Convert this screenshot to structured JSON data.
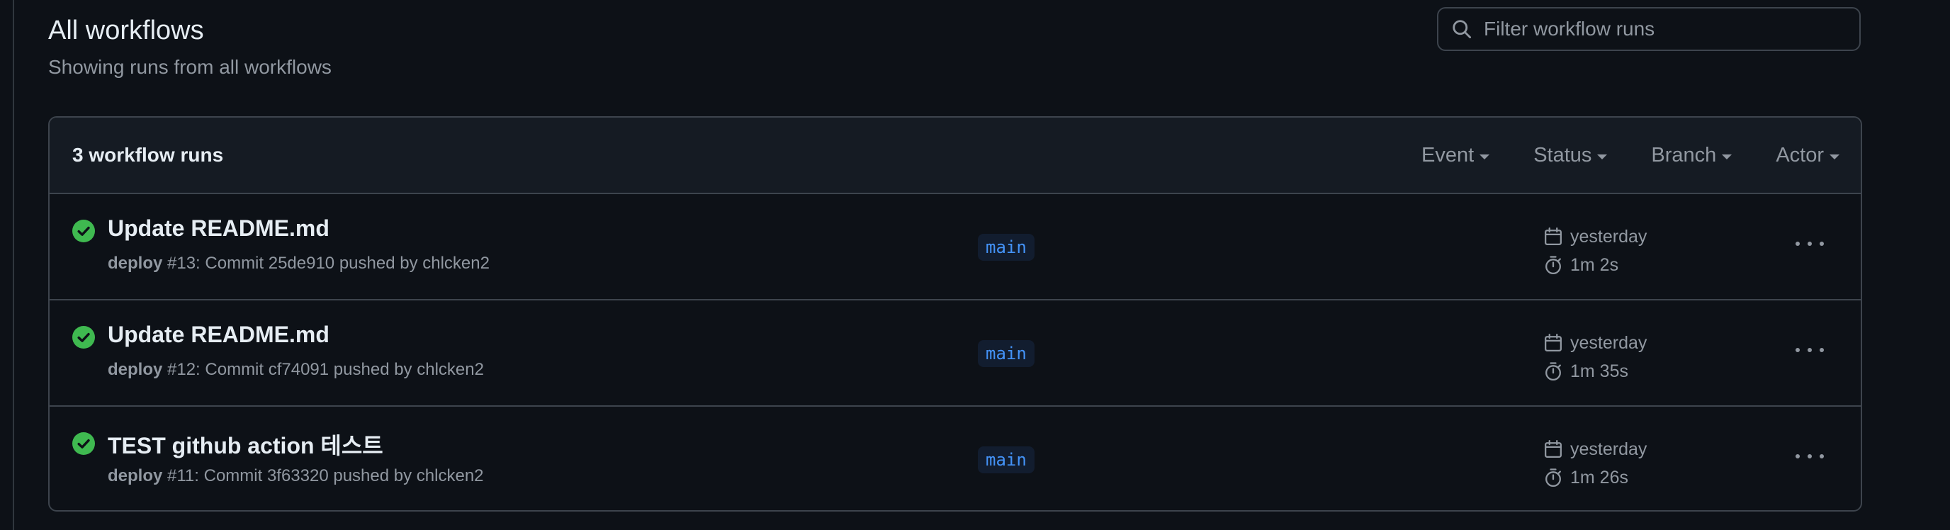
{
  "header": {
    "title": "All workflows",
    "subtitle": "Showing runs from all workflows",
    "filter_placeholder": "Filter workflow runs"
  },
  "runs_list": {
    "count_label": "3 workflow runs",
    "filters": [
      {
        "label": "Event"
      },
      {
        "label": "Status"
      },
      {
        "label": "Branch"
      },
      {
        "label": "Actor"
      }
    ],
    "runs": [
      {
        "title": "Update README.md",
        "workflow": "deploy",
        "detail": " #13: Commit 25de910 pushed by chlcken2",
        "branch": "main",
        "when": "yesterday",
        "duration": "1m 2s",
        "status": "success"
      },
      {
        "title": "Update README.md",
        "workflow": "deploy",
        "detail": " #12: Commit cf74091 pushed by chlcken2",
        "branch": "main",
        "when": "yesterday",
        "duration": "1m 35s",
        "status": "success"
      },
      {
        "title": "TEST github action 테스트",
        "workflow": "deploy",
        "detail": " #11: Commit 3f63320 pushed by chlcken2",
        "branch": "main",
        "when": "yesterday",
        "duration": "1m 26s",
        "status": "success"
      }
    ]
  },
  "colors": {
    "background": "#0d1117",
    "header_bg": "#151b23",
    "border": "#3d444d",
    "text_primary": "#e6edf3",
    "text_muted": "#9198a1",
    "success": "#3fb950",
    "branch_text": "#4493f8",
    "branch_bg": "#121d2f"
  },
  "icons": {
    "search": "search-icon",
    "status": "check-circle-icon",
    "date": "calendar-icon",
    "duration": "stopwatch-icon",
    "menu": "kebab-horizontal-icon"
  }
}
